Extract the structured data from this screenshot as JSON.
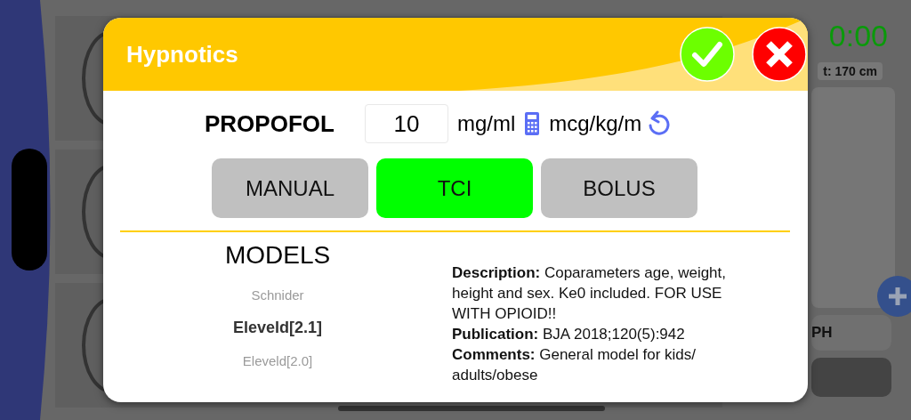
{
  "background": {
    "timer": "0:00",
    "height_label": "t: 170 cm",
    "button_label": "PH"
  },
  "dialog": {
    "title": "Hypnotics",
    "drug": "PROPOFOL",
    "concentration": {
      "value": "10"
    },
    "concentration_unit": "mg/ml",
    "rate_unit": "mcg/kg/m",
    "modes": [
      {
        "label": "MANUAL",
        "selected": false
      },
      {
        "label": "TCI",
        "selected": true
      },
      {
        "label": "BOLUS",
        "selected": false
      }
    ],
    "models_title": "MODELS",
    "models": [
      {
        "label": "Schnider",
        "selected": false
      },
      {
        "label": "Eleveld[2.1]",
        "selected": true
      },
      {
        "label": "Eleveld[2.0]",
        "selected": false
      }
    ],
    "details": [
      "**Description:** Coparameters age, weight, height and sex. Ke0 included. FOR USE WITH OPIOID!!",
      "**Publication:** BJA 2018;120(5):942",
      "**Comments:** General model for kids/ adults/obese"
    ]
  }
}
